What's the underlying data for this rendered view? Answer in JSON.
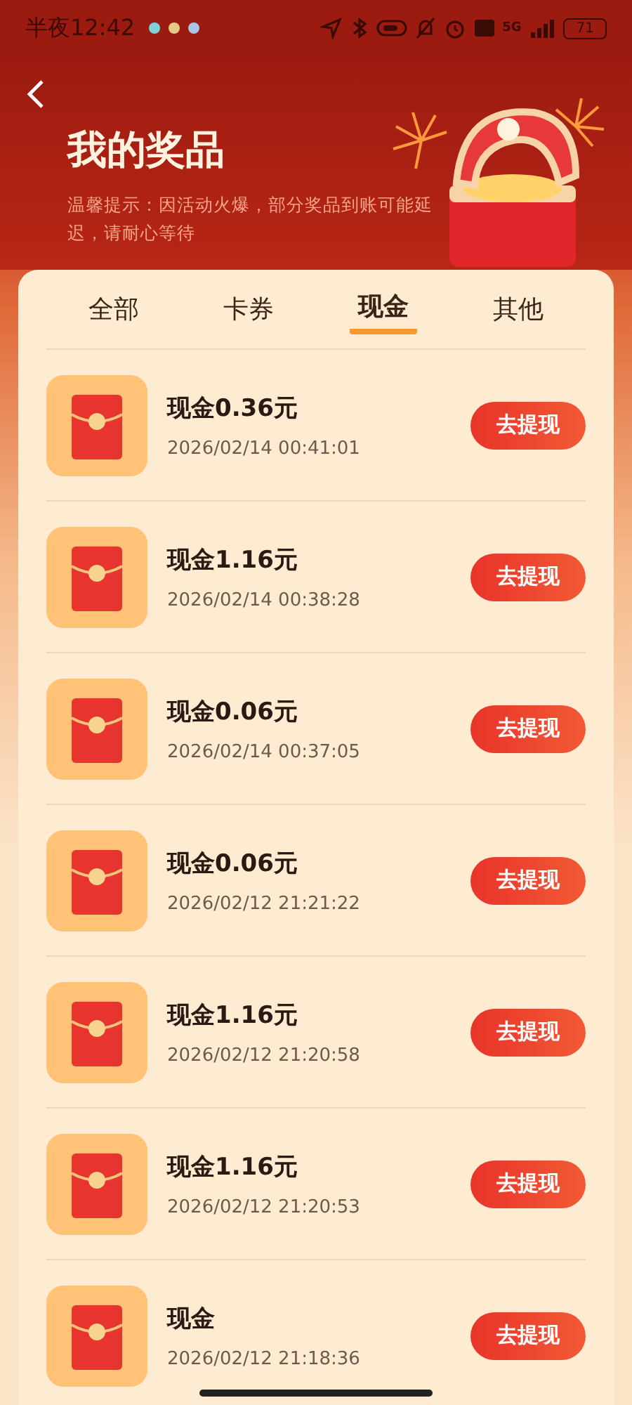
{
  "status_bar": {
    "time": "半夜12:42",
    "network": "5G",
    "battery": "71"
  },
  "header": {
    "title": "我的奖品",
    "notice": "温馨提示：因活动火爆，部分奖品到账可能延迟，请耐心等待"
  },
  "tabs": [
    {
      "label": "全部",
      "selected": false
    },
    {
      "label": "卡券",
      "selected": false
    },
    {
      "label": "现金",
      "selected": true
    },
    {
      "label": "其他",
      "selected": false
    }
  ],
  "prizes": [
    {
      "title": "现金0.36元",
      "time": "2026/02/14 00:41:01",
      "button": "去提现"
    },
    {
      "title": "现金1.16元",
      "time": "2026/02/14 00:38:28",
      "button": "去提现"
    },
    {
      "title": "现金0.06元",
      "time": "2026/02/14 00:37:05",
      "button": "去提现"
    },
    {
      "title": "现金0.06元",
      "time": "2026/02/12 21:21:22",
      "button": "去提现"
    },
    {
      "title": "现金1.16元",
      "time": "2026/02/12 21:20:58",
      "button": "去提现"
    },
    {
      "title": "现金1.16元",
      "time": "2026/02/12 21:20:53",
      "button": "去提现"
    },
    {
      "title": "现金",
      "time": "2026/02/12 21:18:36",
      "button": "去提现"
    }
  ]
}
